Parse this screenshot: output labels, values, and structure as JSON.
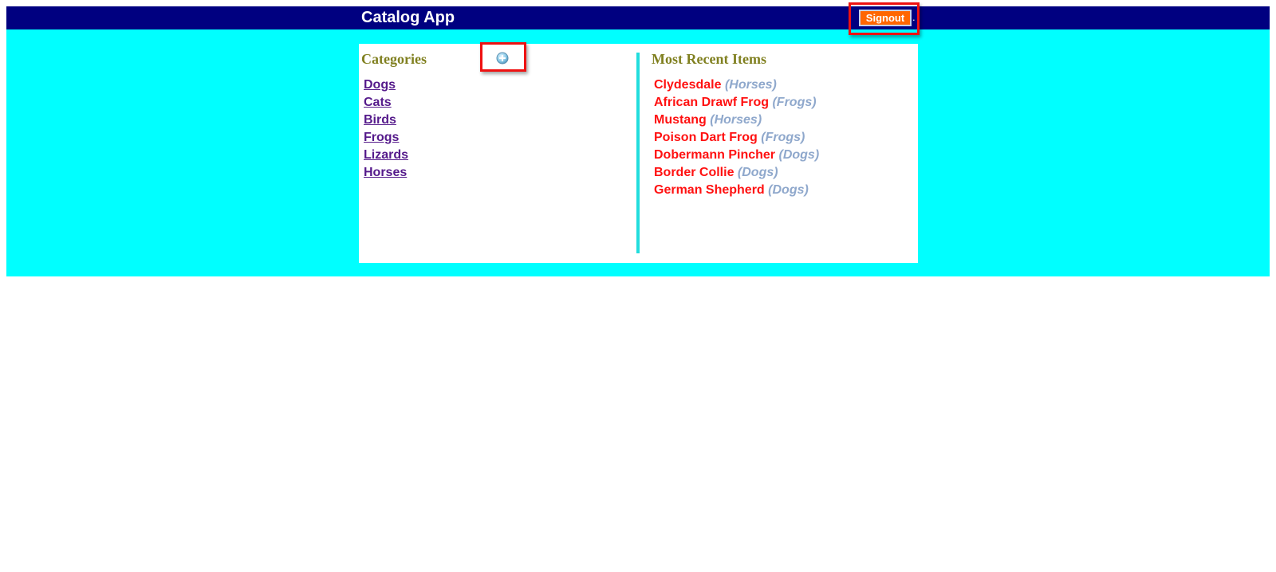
{
  "header": {
    "title": "Catalog App",
    "signout_label": "Signout",
    "signout_suffix": "."
  },
  "categories": {
    "heading": "Categories",
    "add_icon": "add-circle-icon",
    "items": [
      {
        "label": "Dogs"
      },
      {
        "label": "Cats"
      },
      {
        "label": "Birds"
      },
      {
        "label": "Frogs"
      },
      {
        "label": "Lizards"
      },
      {
        "label": "Horses"
      }
    ]
  },
  "recent": {
    "heading": "Most Recent Items",
    "items": [
      {
        "name": "Clydesdale",
        "category": "(Horses)"
      },
      {
        "name": "African Drawf Frog",
        "category": "(Frogs)"
      },
      {
        "name": "Mustang",
        "category": "(Horses)"
      },
      {
        "name": "Poison Dart Frog",
        "category": "(Frogs)"
      },
      {
        "name": "Dobermann Pincher",
        "category": "(Dogs)"
      },
      {
        "name": "Border Collie",
        "category": "(Dogs)"
      },
      {
        "name": "German Shepherd",
        "category": "(Dogs)"
      }
    ]
  },
  "colors": {
    "header_bg": "#000080",
    "page_bg": "#00ffff",
    "signout_bg": "#ff6600",
    "heading": "#808020",
    "item_name": "#ff1111",
    "item_category": "#8fa8cc",
    "category_link": "#551a8b",
    "highlight": "#ee1111"
  }
}
